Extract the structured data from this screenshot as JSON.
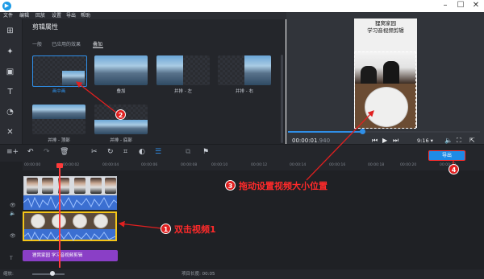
{
  "window": {
    "icon": "video-editor-icon",
    "controls": [
      "minimize-icon",
      "maximize-icon",
      "close-icon"
    ]
  },
  "menu": [
    "文件",
    "编辑",
    "回放",
    "设置",
    "导出",
    "帮助"
  ],
  "sidebar": {
    "tools": [
      "import-icon",
      "magic-wand-icon",
      "crop-panel-icon",
      "text-icon",
      "clock-icon",
      "tools-icon"
    ]
  },
  "panel": {
    "title": "剪辑属性",
    "tabs": [
      "一般",
      "已应用的效果",
      "叠加"
    ],
    "active_tab": "叠加",
    "thumbs": [
      {
        "label": "画中画",
        "selected": true
      },
      {
        "label": "叠加"
      },
      {
        "label": "并排 - 左"
      },
      {
        "label": "并排 - 右"
      },
      {
        "label": "并排 - 顶部"
      },
      {
        "label": "并排 - 底部"
      }
    ]
  },
  "preview": {
    "video_title_line1": "狸窝家园",
    "video_title_line2": "学习音视频剪辑",
    "timecode": "00:00:01",
    "timecode_ms": ".940",
    "aspect": "9:16 ▾",
    "progress": 0.39,
    "controls": [
      "previous-icon",
      "play-icon",
      "next-icon",
      "volume-icon",
      "fullscreen-icon",
      "external-icon"
    ]
  },
  "toolbar": {
    "export_label": "导出"
  },
  "timeline": {
    "ticks": [
      "00:00:00",
      "00:00:02",
      "00:00:04",
      "00:00:06",
      "00:00:08",
      "00:00:10",
      "00:00:12",
      "00:00:14",
      "00:00:16",
      "00:00:18",
      "00:00:20",
      "00:00:22"
    ],
    "title_clip": "狸窝家园 学习音视频剪辑"
  },
  "bottom": {
    "zoom_label": "缩放:",
    "duration": "项目长度: 00:05"
  },
  "annotations": {
    "n1": "1",
    "n2": "2",
    "n3": "3",
    "n4": "4",
    "note1": "双击视频1",
    "note3": "拖动设置视频大小位置",
    "color": "#e02020"
  }
}
